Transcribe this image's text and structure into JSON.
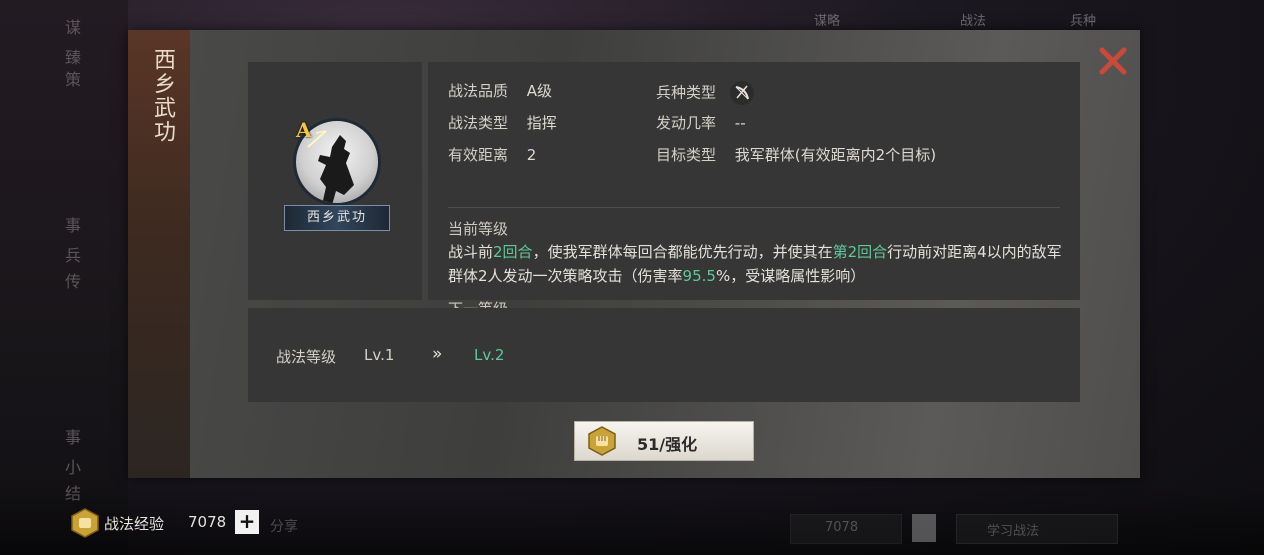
{
  "background": {
    "left_menu": [
      "谋",
      "臻",
      "策",
      "事",
      "兵",
      "传",
      "事",
      "小",
      "结"
    ],
    "top_tabs": [
      "谋略",
      "战法",
      "兵种"
    ],
    "bottom_faded": [
      "分享",
      "7078",
      "学习战法"
    ]
  },
  "skill": {
    "name_vertical": "西乡武功",
    "name_plate": "西乡武功",
    "grade": "A",
    "quality_label": "战法品质",
    "quality_value": "A级",
    "type_label": "战法类型",
    "type_value": "指挥",
    "range_label": "有效距离",
    "range_value": "2",
    "troop_label": "兵种类型",
    "troop_icon": "bow-icon",
    "rate_label": "发动几率",
    "rate_value": "--",
    "target_label": "目标类型",
    "target_value": "我军群体(有效距离内2个目标)",
    "current_level_label": "当前等级",
    "desc": {
      "p1": "战斗前",
      "g1": "2回合",
      "p2": "，使我军群体每回合都能优先行动，并使其在",
      "g2": "第2回合",
      "p3": "行动前对距离4以内的敌军群体2人发动一次策略攻击（伤害率",
      "g3": "95.5",
      "p4": "%，受谋略属性影响）"
    },
    "next_level_label": "下一等级",
    "scroll_hint": "⌄"
  },
  "level": {
    "label": "战法等级",
    "current": "Lv.1",
    "arrow": "»",
    "next": "Lv.2"
  },
  "upgrade": {
    "label": "51/强化",
    "icon": "fist-badge-icon"
  },
  "bottom": {
    "exp_label": "战法经验",
    "exp_value": "7078",
    "plus": "+"
  },
  "colors": {
    "accent_green": "#5fc99a",
    "close_red": "#c84a3a",
    "grade_gold": "#f0c54a"
  }
}
